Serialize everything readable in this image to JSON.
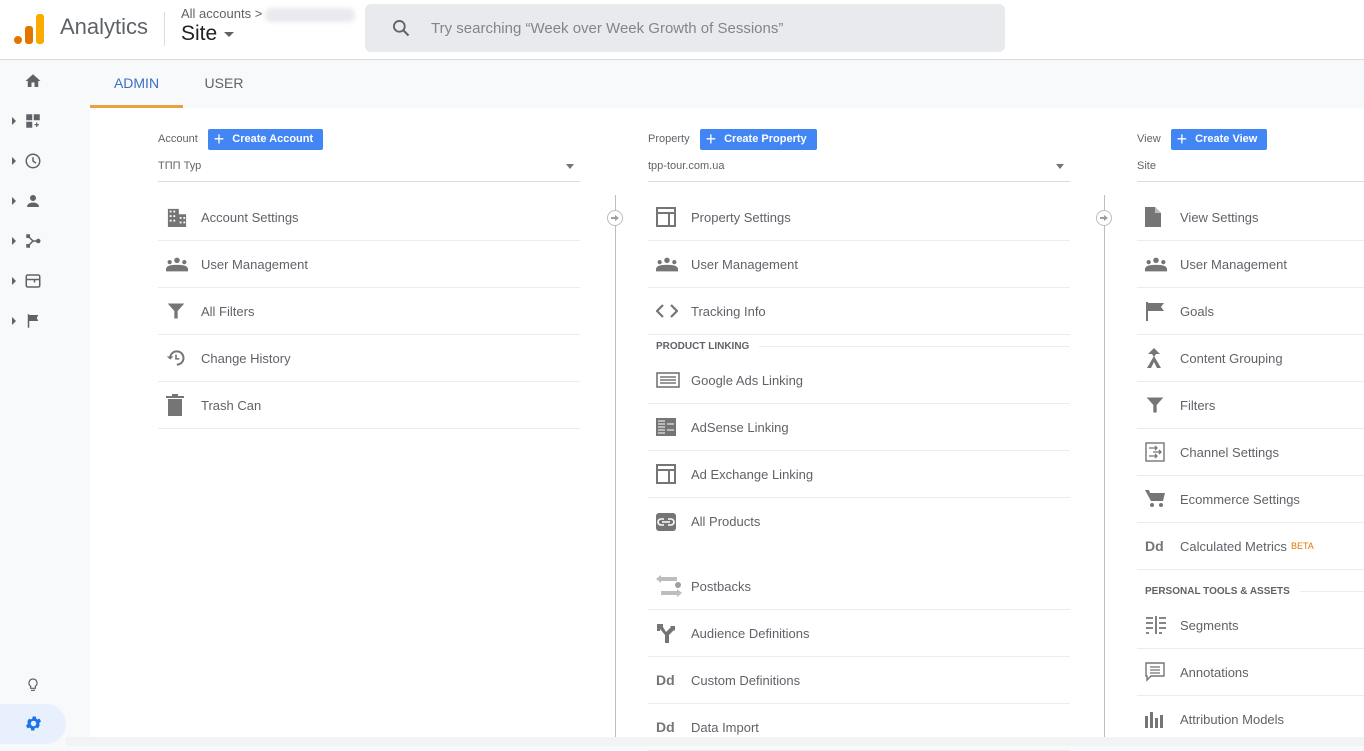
{
  "header": {
    "app_name": "Analytics",
    "breadcrumb": "All accounts >",
    "view_selector": "Site",
    "search_placeholder": "Try searching “Week over Week Growth of Sessions”"
  },
  "leftnav": {
    "items": [
      {
        "name": "home",
        "icon": "home-icon"
      },
      {
        "name": "customization",
        "icon": "dashboard-icon"
      },
      {
        "name": "realtime",
        "icon": "clock-icon"
      },
      {
        "name": "audience",
        "icon": "person-icon"
      },
      {
        "name": "acquisition",
        "icon": "acquisition-icon"
      },
      {
        "name": "behavior",
        "icon": "behavior-icon"
      },
      {
        "name": "conversions",
        "icon": "flag-icon"
      }
    ],
    "bottom": [
      {
        "name": "discover",
        "icon": "lightbulb-icon"
      },
      {
        "name": "admin",
        "icon": "gear-icon",
        "active": true
      }
    ]
  },
  "tabs": [
    {
      "label": "ADMIN",
      "active": true
    },
    {
      "label": "USER",
      "active": false
    }
  ],
  "account": {
    "label": "Account",
    "create_label": "Create Account",
    "selected": "ТПП Тур",
    "items": [
      {
        "label": "Account Settings",
        "icon": "building-icon"
      },
      {
        "label": "User Management",
        "icon": "people-icon"
      },
      {
        "label": "All Filters",
        "icon": "filter-icon"
      },
      {
        "label": "Change History",
        "icon": "history-icon"
      },
      {
        "label": "Trash Can",
        "icon": "trash-icon"
      }
    ]
  },
  "property": {
    "label": "Property",
    "create_label": "Create Property",
    "selected": "tpp-tour.com.ua",
    "items": [
      {
        "label": "Property Settings",
        "icon": "property-icon"
      },
      {
        "label": "User Management",
        "icon": "people-icon"
      },
      {
        "label": "Tracking Info",
        "icon": "code-icon"
      }
    ],
    "section_product_linking": "PRODUCT LINKING",
    "linking_items": [
      {
        "label": "Google Ads Linking",
        "icon": "google-ads-icon"
      },
      {
        "label": "AdSense Linking",
        "icon": "adsense-icon"
      },
      {
        "label": "Ad Exchange Linking",
        "icon": "ad-exchange-icon"
      },
      {
        "label": "All Products",
        "icon": "link-icon"
      }
    ],
    "more_items": [
      {
        "label": "Postbacks",
        "icon": "postbacks-icon"
      },
      {
        "label": "Audience Definitions",
        "icon": "audience-icon"
      },
      {
        "label": "Custom Definitions",
        "icon": "dd-icon"
      },
      {
        "label": "Data Import",
        "icon": "dd-icon"
      }
    ]
  },
  "view": {
    "label": "View",
    "create_label": "Create View",
    "selected": "Site",
    "items": [
      {
        "label": "View Settings",
        "icon": "document-icon"
      },
      {
        "label": "User Management",
        "icon": "people-icon"
      },
      {
        "label": "Goals",
        "icon": "flag-icon"
      },
      {
        "label": "Content Grouping",
        "icon": "merge-icon"
      },
      {
        "label": "Filters",
        "icon": "filter-icon"
      },
      {
        "label": "Channel Settings",
        "icon": "channel-icon"
      },
      {
        "label": "Ecommerce Settings",
        "icon": "cart-icon"
      },
      {
        "label": "Calculated Metrics",
        "icon": "dd-icon",
        "badge": "BETA"
      }
    ],
    "section_personal": "PERSONAL TOOLS & ASSETS",
    "personal_items": [
      {
        "label": "Segments",
        "icon": "segments-icon"
      },
      {
        "label": "Annotations",
        "icon": "annotation-icon"
      },
      {
        "label": "Attribution Models",
        "icon": "attribution-icon"
      }
    ]
  }
}
